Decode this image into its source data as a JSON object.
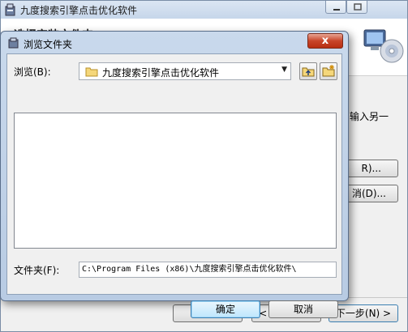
{
  "main_window": {
    "title": "九度搜索引擎点击优化软件",
    "header_title": "选择安装文件夹",
    "body_text_fragment": "输入另一",
    "browse_button_fragment": "R)...",
    "disk_button_fragment": "消(D)...",
    "cancel_label": "取消",
    "back_label": "< 上一步(B)",
    "next_label": "下一步(N) >"
  },
  "dialog": {
    "title": "浏览文件夹",
    "close_glyph": "x",
    "browse_label": "浏览(B):",
    "browse_value": "九度搜索引擎点击优化软件",
    "folder_label": "文件夹(F):",
    "folder_value": "C:\\Program Files (x86)\\九度搜索引擎点击优化软件\\",
    "ok_label": "确定",
    "cancel_label": "取消"
  },
  "colors": {
    "dialog_frame": "#b8cbe3",
    "close_button": "#c8452a",
    "default_button": "#bee6fd"
  }
}
